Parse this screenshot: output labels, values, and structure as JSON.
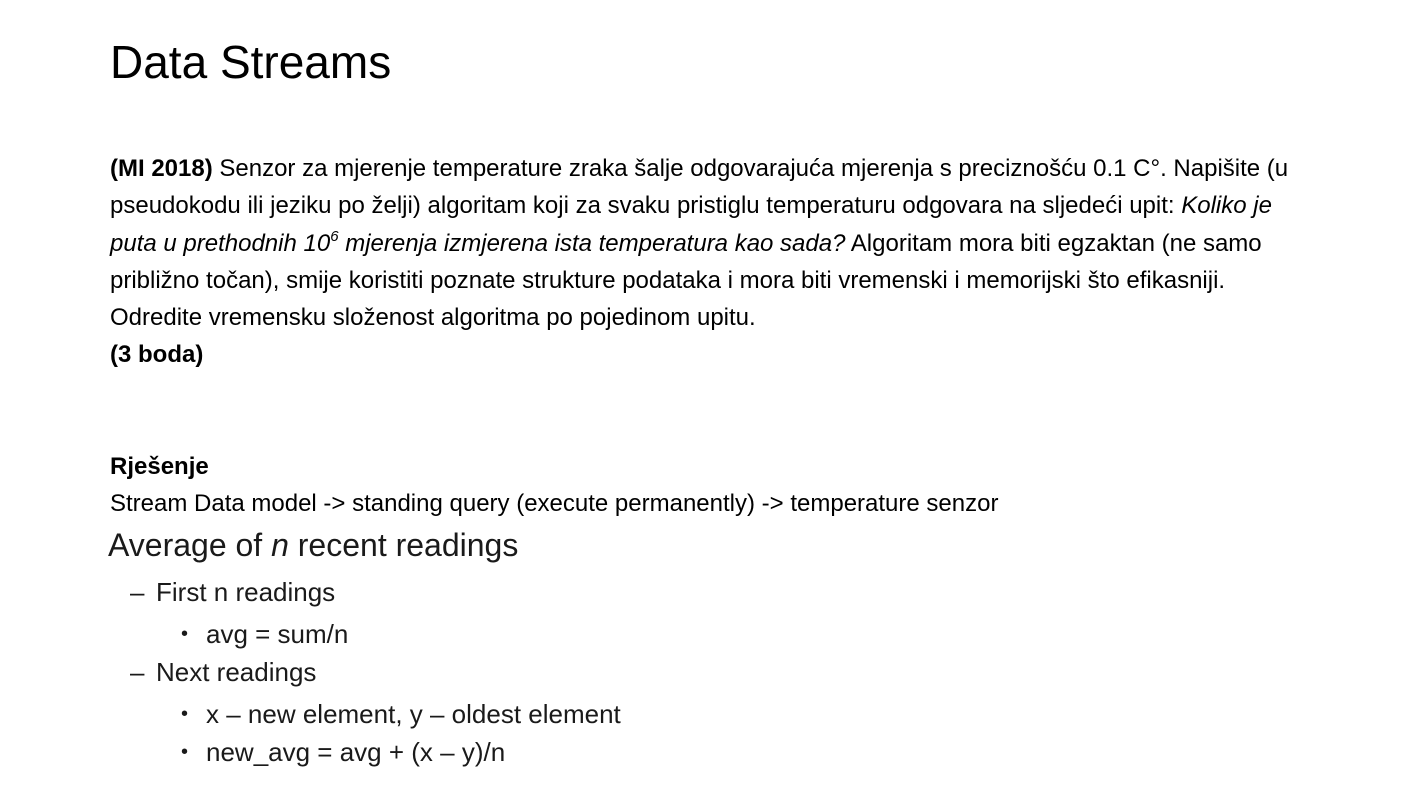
{
  "title": "Data Streams",
  "problem": {
    "label": "(MI 2018)",
    "text_1": " Senzor za mjerenje temperature zraka šalje odgovarajuća mjerenja s preciznošću 0.1 C°. Napišite (u pseudokodu ili jeziku po želji) algoritam koji za svaku pristiglu temperaturu odgovara na sljedeći upit: ",
    "query_italic_1": "Koliko je puta u prethodnih 10",
    "query_exponent": "6",
    "query_italic_2": " mjerenja izmjerena ista temperatura kao sada?",
    "text_2": " Algoritam mora biti egzaktan (ne samo približno točan), smije koristiti poznate strukture podataka i mora biti vremenski i memorijski što efikasniji. Odredite vremensku složenost algoritma po pojedinom upitu.",
    "points": "(3 boda)"
  },
  "solution": {
    "heading": "Rješenje",
    "line": "Stream Data model -> standing query (execute permanently) -> temperature senzor"
  },
  "slide": {
    "title_prefix": "Average of ",
    "title_italic": "n",
    "title_suffix": " recent readings",
    "items": [
      {
        "label": "First n readings",
        "subitems": [
          "avg = sum/n"
        ]
      },
      {
        "label": "Next readings",
        "subitems": [
          "x – new element, y – oldest element",
          "new_avg = avg + (x – y)/n"
        ]
      }
    ],
    "dash_glyph": "–",
    "bullet_glyph": "•"
  }
}
